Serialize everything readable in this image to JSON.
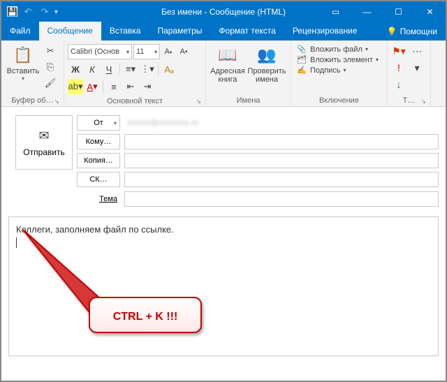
{
  "window": {
    "title": "Без имени - Сообщение (HTML)"
  },
  "tabs": {
    "file": "Файл",
    "message": "Сообщение",
    "insert": "Вставка",
    "options": "Параметры",
    "format": "Формат текста",
    "review": "Рецензирование",
    "tell_me": "Помощни"
  },
  "ribbon": {
    "clipboard": {
      "paste": "Вставить",
      "group": "Буфер об…"
    },
    "font": {
      "name": "Calibri (Основ",
      "size": "11",
      "group": "Основной текст"
    },
    "names": {
      "address_book_l1": "Адресная",
      "address_book_l2": "книга",
      "check_names_l1": "Проверить",
      "check_names_l2": "имена",
      "group": "Имена"
    },
    "include": {
      "attach_file": "Вложить файл",
      "attach_item": "Вложить элемент",
      "signature": "Подпись",
      "group": "Включение"
    },
    "tags": {
      "group": "Т…"
    }
  },
  "compose": {
    "send": "Отправить",
    "from": "От",
    "from_value": "xxxxxx@xxxxxxxx.xx",
    "to": "Кому…",
    "cc": "Копия…",
    "bcc": "СК…",
    "subject": "Тема"
  },
  "body": {
    "line1": "Коллеги, заполняем файл по ссылке."
  },
  "callout": {
    "text": "CTRL + K !!!"
  }
}
